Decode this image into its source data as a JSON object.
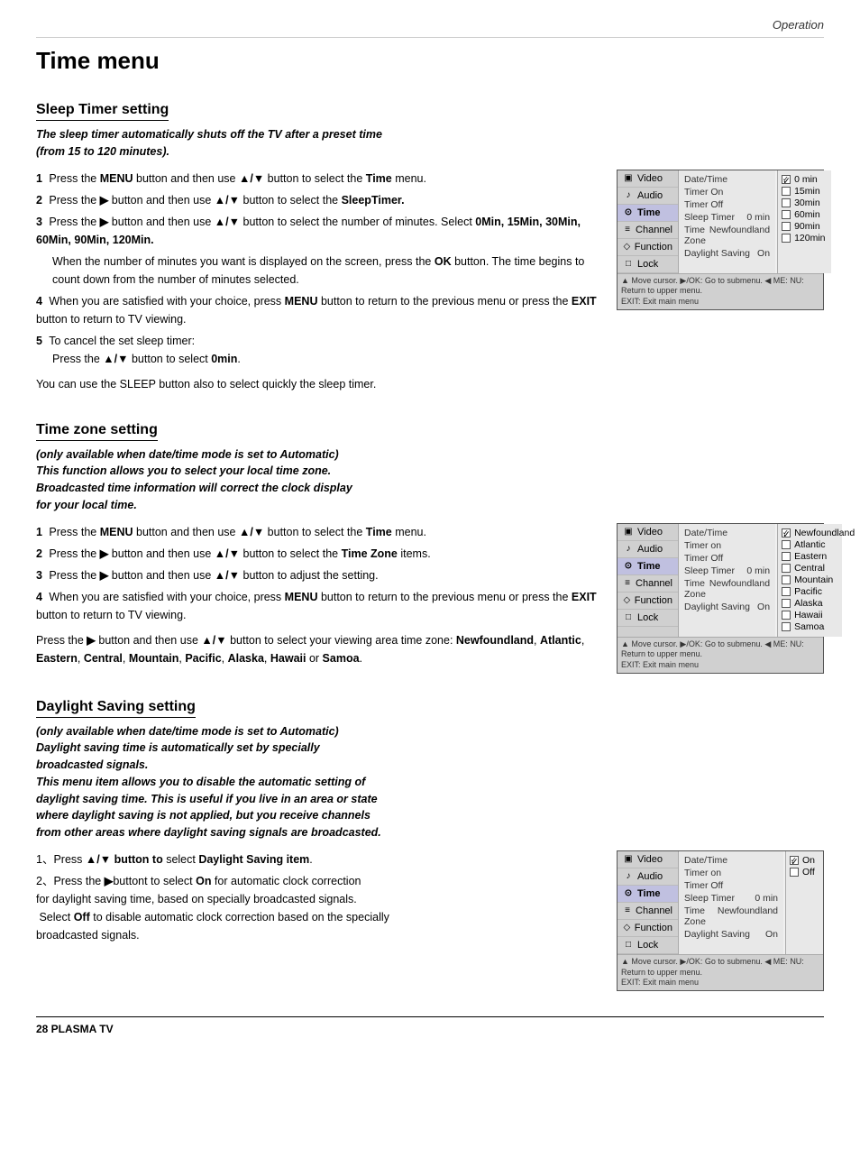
{
  "header": {
    "operation_label": "Operation"
  },
  "page_title": "Time menu",
  "sections": [
    {
      "id": "sleep-timer",
      "title": "Sleep Timer setting",
      "intro": "The sleep timer automatically shuts off the TV after a preset time\n(from 15 to 120 minutes).",
      "steps": [
        {
          "num": "1",
          "text": "Press the MENU button and then use ▲/▼ button to select the Time menu."
        },
        {
          "num": "2",
          "text": "Press the ▶ button and then use ▲/▼ button to select the SleepTimer."
        },
        {
          "num": "3",
          "text": "Press the ▶ button and then use ▲/▼ button to select the number of minutes. Select 0Min, 15Min, 30Min, 60Min, 90Min, 120Min."
        },
        {
          "num": "4",
          "text": "When you are satisfied with your choice, press MENU button to return to the previous menu or press the EXIT button to return to TV viewing."
        },
        {
          "num": "5",
          "text": "To cancel the set sleep timer: Press the ▲/▼ button to select 0min."
        }
      ],
      "extra_text": "When the number of minutes you want is displayed on the screen, press the OK button. The time begins to count down from the number of minutes selected.",
      "note": "You can use the SLEEP button also to select quickly the sleep timer.",
      "menu": {
        "left_items": [
          "Video",
          "Audio",
          "Time",
          "Channel",
          "Function",
          "Lock"
        ],
        "active_item": "Time",
        "right_rows": [
          {
            "label": "Date/Time",
            "value": ""
          },
          {
            "label": "Timer On",
            "value": ""
          },
          {
            "label": "Timer Off",
            "value": ""
          },
          {
            "label": "Sleep Timer",
            "value": "0 min"
          },
          {
            "label": "Time Zone",
            "value": "Newfoundland"
          },
          {
            "label": "Daylight Saving",
            "value": "On"
          }
        ],
        "options": [
          {
            "label": "0 min",
            "checked": true
          },
          {
            "label": "15min",
            "checked": false
          },
          {
            "label": "30min",
            "checked": false
          },
          {
            "label": "60min",
            "checked": false
          },
          {
            "label": "90min",
            "checked": false
          },
          {
            "label": "120min",
            "checked": false
          }
        ],
        "footer": "▲ Move cursor. ▶/OK: Go to submenu. ◀ ME: NU: Return to upper menu.\nEXIT: Exit main menu"
      }
    },
    {
      "id": "time-zone",
      "title": "Time zone setting",
      "intro": "(only available when date/time mode is set to Automatic)\nThis function allows you to select your local time zone.\nBroadcasted time information will correct the clock display\nfor your local time.",
      "steps": [
        {
          "num": "1",
          "text": "Press the MENU button and then use ▲/▼ button to select the Time menu."
        },
        {
          "num": "2",
          "text": "Press the ▶ button and then use ▲/▼ button to select the Time Zone items."
        },
        {
          "num": "3",
          "text": "Press the ▶ button and then use ▲/▼ button to adjust the setting."
        },
        {
          "num": "4",
          "text": "When you are satisfied with your choice, press MENU button to return to the previous menu or press the EXIT button to return to TV viewing."
        }
      ],
      "extra_text": "Press the ▶ button and then use ▲/▼ button to select your viewing area time zone: Newfoundland, Atlantic, Eastern, Central, Mountain, Pacific, Alaska, Hawaii or Samoa.",
      "menu": {
        "left_items": [
          "Video",
          "Audio",
          "Time",
          "Channel",
          "Function",
          "Lock"
        ],
        "active_item": "Time",
        "right_rows": [
          {
            "label": "Date/Time",
            "value": ""
          },
          {
            "label": "Timer on",
            "value": ""
          },
          {
            "label": "Timer Off",
            "value": ""
          },
          {
            "label": "Sleep Timer",
            "value": "0 min"
          },
          {
            "label": "Time Zone",
            "value": "Newfoundland"
          },
          {
            "label": "Daylight Saving",
            "value": "On"
          }
        ],
        "options": [
          {
            "label": "Newfoundland",
            "checked": true
          },
          {
            "label": "Atlantic",
            "checked": false
          },
          {
            "label": "Eastern",
            "checked": false
          },
          {
            "label": "Central",
            "checked": false
          },
          {
            "label": "Mountain",
            "checked": false
          },
          {
            "label": "Pacific",
            "checked": false
          },
          {
            "label": "Alaska",
            "checked": false
          },
          {
            "label": "Hawaii",
            "checked": false
          },
          {
            "label": "Samoa",
            "checked": false
          }
        ],
        "footer": "▲ Move cursor. ▶/OK: Go to submenu. ◀ ME: NU: Return to upper menu.\nEXIT: Exit main menu"
      }
    },
    {
      "id": "daylight-saving",
      "title": "Daylight Saving setting",
      "intro": "(only available when date/time mode is set to Automatic)\nDaylight saving time is automatically set by specially\nbroadcasted signals.\nThis menu item allows you to disable the automatic setting of\ndaylight saving time. This is useful if you live in an area or state\nwhere daylight saving is not applied, but you receive channels\nfrom other areas where daylight saving signals are broadcasted.",
      "steps": [
        {
          "num": "1",
          "text": "Press ▲/▼ button to select Daylight Saving item."
        },
        {
          "num": "2",
          "text": "Press the ▶ buttont to select On for automatic clock correction for daylight saving time, based on specially broadcasted signals. Select Off to disable automatic clock correction based on the specially broadcasted signals."
        }
      ],
      "menu": {
        "left_items": [
          "Video",
          "Audio",
          "Time",
          "Channel",
          "Function",
          "Lock"
        ],
        "active_item": "Time",
        "right_rows": [
          {
            "label": "Date/Time",
            "value": ""
          },
          {
            "label": "Timer on",
            "value": ""
          },
          {
            "label": "Timer Off",
            "value": ""
          },
          {
            "label": "Sleep Timer",
            "value": "0 min"
          },
          {
            "label": "Time Zone",
            "value": "Newfoundland"
          },
          {
            "label": "Daylight Saving",
            "value": "On"
          }
        ],
        "options": [
          {
            "label": "On",
            "checked": true
          },
          {
            "label": "Off",
            "checked": false
          }
        ],
        "footer": "▲ Move cursor. ▶/OK: Go to submenu. ◀ ME: NU: Return to upper menu.\nEXIT: Exit main menu"
      }
    }
  ],
  "footer": {
    "label": "28   PLASMA TV"
  },
  "icons": {
    "video": "▣",
    "audio": "♪",
    "time": "⊙",
    "channel": "≡",
    "function": "◇",
    "lock": "□"
  }
}
